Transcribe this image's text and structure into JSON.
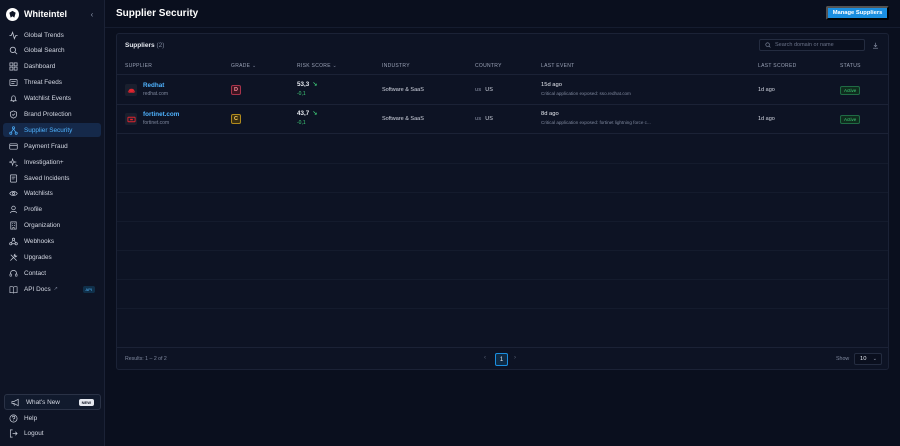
{
  "app": {
    "name": "Whiteintel",
    "collapse_icon": "chevron-left-icon"
  },
  "sidebar": {
    "items": [
      {
        "label": "Global Trends",
        "icon": "activity-icon"
      },
      {
        "label": "Global Search",
        "icon": "search-icon"
      },
      {
        "label": "Dashboard",
        "icon": "grid-icon"
      },
      {
        "label": "Threat Feeds",
        "icon": "feed-icon"
      },
      {
        "label": "Watchlist Events",
        "icon": "bell-icon"
      },
      {
        "label": "Brand Protection",
        "icon": "shield-icon"
      },
      {
        "label": "Supplier Security",
        "icon": "network-icon",
        "active": true
      },
      {
        "label": "Payment Fraud",
        "icon": "credit-card-icon"
      },
      {
        "label": "Investigation+",
        "icon": "sparkle-icon"
      },
      {
        "label": "Saved Incidents",
        "icon": "bookmark-icon"
      },
      {
        "label": "Watchlists",
        "icon": "eye-icon"
      },
      {
        "label": "Profile",
        "icon": "user-icon"
      },
      {
        "label": "Organization",
        "icon": "building-icon"
      },
      {
        "label": "Webhooks",
        "icon": "webhook-icon"
      },
      {
        "label": "Upgrades",
        "icon": "tools-icon"
      },
      {
        "label": "Contact",
        "icon": "headset-icon"
      },
      {
        "label": "API Docs",
        "icon": "book-icon",
        "badge": "API"
      }
    ],
    "whats_new": {
      "label": "What's New",
      "badge": "NEW"
    },
    "bottom": [
      {
        "label": "Help",
        "icon": "help-icon"
      },
      {
        "label": "Logout",
        "icon": "logout-icon"
      }
    ]
  },
  "header": {
    "title": "Supplier Security",
    "manage_button": "Manage Suppliers"
  },
  "suppliers_card": {
    "title": "Suppliers",
    "count": "(2)",
    "search_placeholder": "Search domain or name",
    "columns": {
      "supplier": "SUPPLIER",
      "grade": "GRADE",
      "risk_score": "RISK SCORE",
      "industry": "INDUSTRY",
      "country": "COUNTRY",
      "last_event": "LAST EVENT",
      "last_scored": "LAST SCORED",
      "status": "STATUS"
    },
    "rows": [
      {
        "name": "Redhat",
        "domain": "redhat.com",
        "grade": "D",
        "risk_score": "53,3",
        "delta": "-0,1",
        "industry": "Software & SaaS",
        "country_code": "US",
        "country": "US",
        "last_event_time": "15d ago",
        "last_event_desc": "Critical application exposed: sso.redhat.com",
        "last_scored": "1d ago",
        "status": "Active"
      },
      {
        "name": "fortinet.com",
        "domain": "fortinet.com",
        "grade": "C",
        "risk_score": "43,7",
        "delta": "-0,1",
        "industry": "Software & SaaS",
        "country_code": "US",
        "country": "US",
        "last_event_time": "8d ago",
        "last_event_desc": "Critical application exposed: fortinet lightning force c...",
        "last_scored": "1d ago",
        "status": "Active"
      }
    ],
    "footer": {
      "results": "Results: 1 – 2 of 2",
      "current_page": "1",
      "show_label": "Show",
      "page_size": "10"
    }
  },
  "colors": {
    "accent": "#1b8fe0",
    "background": "#0a0f1e",
    "active_nav": "#4fb3ff",
    "success": "#3fd07a"
  }
}
